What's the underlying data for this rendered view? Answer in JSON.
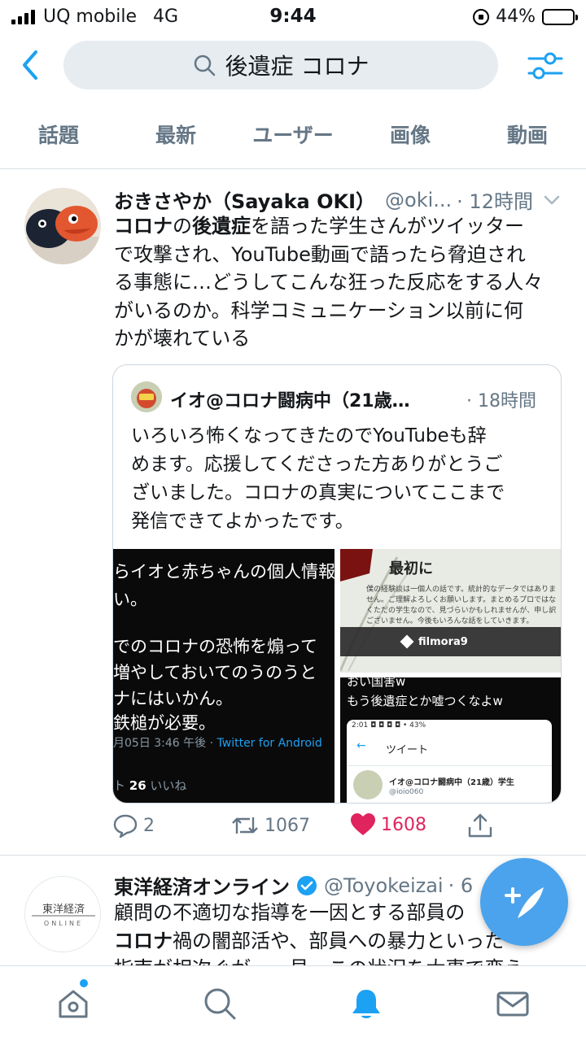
{
  "status_bar": {
    "carrier": "UQ mobile",
    "network": "4G",
    "time": "9:44",
    "battery_percent": "44%",
    "battery_level": 0.44
  },
  "search": {
    "query": "後遺症 コロナ",
    "back_icon": "chevron-left-icon",
    "filter_icon": "sliders-icon"
  },
  "tabs": [
    {
      "label": "話題",
      "active": true
    },
    {
      "label": "最新",
      "active": false
    },
    {
      "label": "ユーザー",
      "active": false
    },
    {
      "label": "画像",
      "active": false
    },
    {
      "label": "動画",
      "active": false
    }
  ],
  "tweets": [
    {
      "name": "おきさやか（Sayaka OKI）",
      "handle": "@oki...",
      "time": "· 12時間",
      "text_lines": [
        [
          {
            "t": "コロナ",
            "b": true
          },
          {
            "t": "の",
            "b": false
          },
          {
            "t": "後遺症",
            "b": true
          },
          {
            "t": "を語った学生さんがツイッター",
            "b": false
          }
        ],
        [
          {
            "t": "で攻撃され、YouTube動画で語ったら脅迫され",
            "b": false
          }
        ],
        [
          {
            "t": "る事態に…どうしてこんな狂った反応をする人々",
            "b": false
          }
        ],
        [
          {
            "t": "がいるのか。科学コミュニケーション以前に何",
            "b": false
          }
        ],
        [
          {
            "t": "かが壊れている",
            "b": false
          }
        ]
      ],
      "quote": {
        "name": "イオ@コロナ闘病中（21歳…",
        "time": "· 18時間",
        "text_lines": [
          "いろいろ怖くなってきたのでYouTubeも辞",
          "めます。応援してくださった方ありがとうご",
          "ざいました。コロナの真実についてここまで",
          "発信できてよかったです。"
        ],
        "media": {
          "left_lines": [
            "らイオと赤ちゃんの個人情報",
            "い。",
            "",
            "でのコロナの恐怖を煽って",
            "増やしておいてのうのうと",
            "ナにはいかん。",
            "鉄槌が必要。"
          ],
          "left_meta_time": "月05日 3:46 午後 · ",
          "left_meta_source": "Twitter for Android",
          "left_likes_prefix": "ト ",
          "left_likes_count": "26",
          "left_likes_label": " いいね",
          "slide_title": "最初に",
          "slide_body": "僕の経験談は一個人の話です。統計的なデータではありません。ご理解よろしくお願いします。まとめるプロではなくただの学生なので、見づらいかもしれませんが、申し訳ございません。今後もいろんな話をしていきます。",
          "slide_badge": "filmora9",
          "right_lines": [
            "おい国害w",
            "もう後遺症とか嘘つくなよw"
          ],
          "phone_status": "2:01 ◘ ◘ ◘ ◘ •                         43%",
          "phone_back": "←",
          "phone_title": "ツイート",
          "phone_name": "イオ@コロナ闘病中（21歳）学生",
          "phone_handle": "@ioio060"
        }
      },
      "actions": {
        "replies": "2",
        "retweets": "1067",
        "likes": "1608",
        "liked": true
      }
    },
    {
      "name": "東洋経済オンライン",
      "handle": "@Toyokeizai",
      "time": "· 6",
      "verified": true,
      "text_lines": [
        [
          {
            "t": "顧問の不適切な指導を一因とする部員の",
            "b": false
          }
        ],
        [
          {
            "t": "コロナ",
            "b": true
          },
          {
            "t": "禍の闇部活や、部員への暴力といった",
            "b": false
          }
        ],
        [
          {
            "t": "指南が相次ぐが、一見、この状況を大事で変え",
            "b": false
          }
        ]
      ],
      "avatar_text": "東洋経済",
      "avatar_sub": "ONLINE"
    }
  ],
  "bottom_nav": [
    {
      "icon": "home-icon",
      "has_dot": true
    },
    {
      "icon": "search-icon",
      "has_dot": false
    },
    {
      "icon": "bell-icon",
      "active": true
    },
    {
      "icon": "mail-icon",
      "has_dot": false
    }
  ],
  "colors": {
    "accent": "#1da1f2",
    "like": "#e0245e",
    "secondary_text": "#657786",
    "search_bg": "#e6ecf0",
    "fab": "#4aa3ec"
  }
}
